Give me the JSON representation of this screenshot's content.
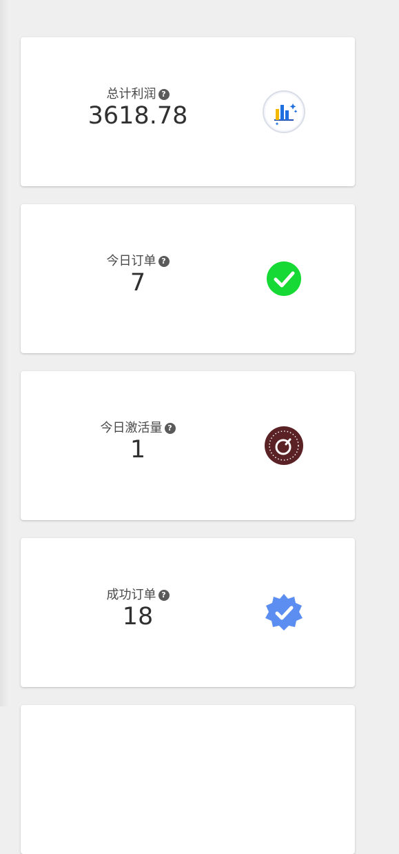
{
  "cards": [
    {
      "label": "总计利润",
      "value": "3618.78",
      "icon": "bar-chart-icon"
    },
    {
      "label": "今日订单",
      "value": "7",
      "icon": "check-circle-icon"
    },
    {
      "label": "今日激活量",
      "value": "1",
      "icon": "gauge-icon"
    },
    {
      "label": "成功订单",
      "value": "18",
      "icon": "verified-badge-icon"
    }
  ],
  "help_glyph": "?",
  "colors": {
    "background": "#efeff0",
    "card": "#ffffff",
    "check_green": "#16d936",
    "gauge_brown": "#5a2224",
    "verified_blue": "#5b8ef0",
    "chart_yellow": "#f5b800",
    "chart_blue": "#1f6fe0"
  }
}
